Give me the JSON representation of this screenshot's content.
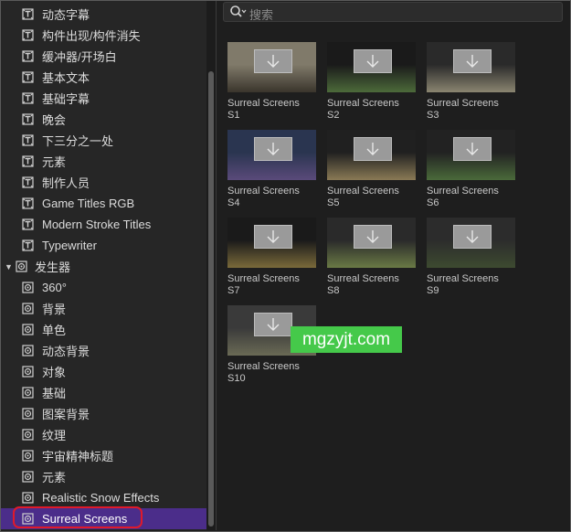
{
  "sidebar": {
    "items": [
      {
        "label": "动态字幕",
        "icon": "title-icon",
        "level": 1
      },
      {
        "label": "构件出现/构件消失",
        "icon": "title-icon",
        "level": 1
      },
      {
        "label": "缓冲器/开场白",
        "icon": "title-icon",
        "level": 1
      },
      {
        "label": "基本文本",
        "icon": "title-icon",
        "level": 1
      },
      {
        "label": "基础字幕",
        "icon": "title-icon",
        "level": 1
      },
      {
        "label": "晚会",
        "icon": "title-icon",
        "level": 1
      },
      {
        "label": "下三分之一处",
        "icon": "title-icon",
        "level": 1
      },
      {
        "label": "元素",
        "icon": "title-icon",
        "level": 1
      },
      {
        "label": "制作人员",
        "icon": "title-icon",
        "level": 1
      },
      {
        "label": "Game Titles RGB",
        "icon": "title-icon",
        "level": 1
      },
      {
        "label": "Modern Stroke Titles",
        "icon": "title-icon",
        "level": 1
      },
      {
        "label": "Typewriter",
        "icon": "title-icon",
        "level": 1
      },
      {
        "label": "发生器",
        "icon": "generator-icon",
        "level": 0,
        "expanded": true
      },
      {
        "label": "360°",
        "icon": "generator-icon",
        "level": 1
      },
      {
        "label": "背景",
        "icon": "generator-icon",
        "level": 1
      },
      {
        "label": "单色",
        "icon": "generator-icon",
        "level": 1
      },
      {
        "label": "动态背景",
        "icon": "generator-icon",
        "level": 1
      },
      {
        "label": "对象",
        "icon": "generator-icon",
        "level": 1
      },
      {
        "label": "基础",
        "icon": "generator-icon",
        "level": 1
      },
      {
        "label": "图案背景",
        "icon": "generator-icon",
        "level": 1
      },
      {
        "label": "纹理",
        "icon": "generator-icon",
        "level": 1
      },
      {
        "label": "宇宙精神标题",
        "icon": "generator-icon",
        "level": 1
      },
      {
        "label": "元素",
        "icon": "generator-icon",
        "level": 1
      },
      {
        "label": "Realistic Snow Effects",
        "icon": "generator-icon",
        "level": 1
      },
      {
        "label": "Surreal Screens",
        "icon": "generator-icon",
        "level": 1,
        "selected": true
      }
    ]
  },
  "search": {
    "placeholder": "搜索",
    "icon": "search-icon"
  },
  "grid": {
    "tiles": [
      {
        "name": "Surreal Screens\nS1",
        "scene": [
          "#807a6a",
          "#3a352c"
        ]
      },
      {
        "name": "Surreal Screens\nS2",
        "scene": [
          "#1a1a1a",
          "#4c6a3a"
        ]
      },
      {
        "name": "Surreal Screens\nS3",
        "scene": [
          "#2a2a2a",
          "#8a8570"
        ]
      },
      {
        "name": "Surreal Screens\nS4",
        "scene": [
          "#2a3550",
          "#5a4a7a"
        ]
      },
      {
        "name": "Surreal Screens\nS5",
        "scene": [
          "#202020",
          "#8a7a55"
        ]
      },
      {
        "name": "Surreal Screens\nS6",
        "scene": [
          "#222222",
          "#4a6a3a"
        ]
      },
      {
        "name": "Surreal Screens\nS7",
        "scene": [
          "#1a1a1a",
          "#7a6a3a"
        ]
      },
      {
        "name": "Surreal Screens\nS8",
        "scene": [
          "#2a2a2a",
          "#6a7a45"
        ]
      },
      {
        "name": "Surreal Screens\nS9",
        "scene": [
          "#2c2c2c",
          "#3d4a30"
        ]
      },
      {
        "name": "Surreal Screens\nS10",
        "scene": [
          "#3a3a3a",
          "#6a6a55"
        ]
      }
    ]
  },
  "watermark": {
    "text": "mgzyjt.com"
  },
  "colors": {
    "accent_selected": "#4b2d8a",
    "highlight_ring": "#e0192a",
    "watermark_bg": "#45c94a"
  }
}
